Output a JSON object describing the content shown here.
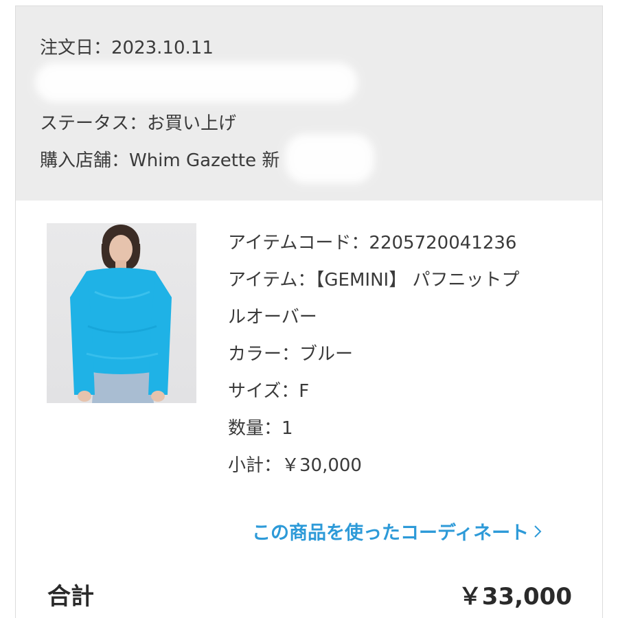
{
  "order": {
    "date": "注文日：2023.10.11",
    "status": "ステータス：お買い上げ",
    "store": "購入店舗：Whim Gazette 新"
  },
  "item": {
    "code": "アイテムコード：2205720041236",
    "name_line1": "アイテム：【GEMINI】 パフニットプ",
    "name_line2": "ルオーバー",
    "color": "カラー：ブルー",
    "size": "サイズ：F",
    "quantity": "数量：1",
    "subtotal": "小計：￥30,000",
    "sweater_color": "#1fb2e6"
  },
  "coordinate_link": {
    "label": "この商品を使ったコーディネート",
    "icon": "chevron-right-icon"
  },
  "total": {
    "label": "合計",
    "value": "￥33,000"
  }
}
